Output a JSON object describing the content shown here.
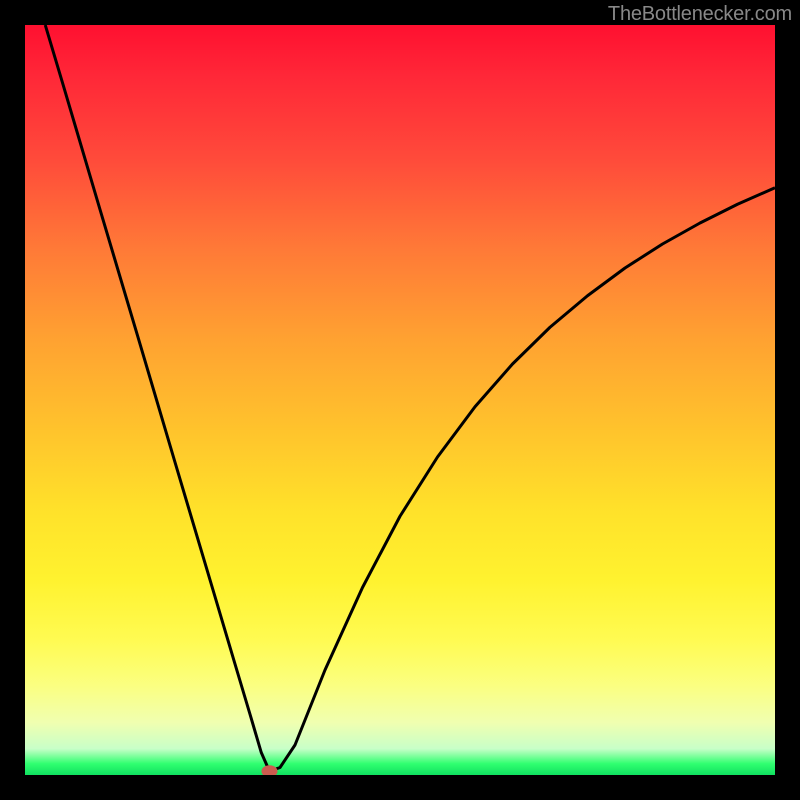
{
  "watermark": "TheBottlenecker.com",
  "chart_data": {
    "type": "line",
    "title": "",
    "xlabel": "",
    "ylabel": "",
    "xlim": [
      0,
      100
    ],
    "ylim": [
      0,
      100
    ],
    "legend": false,
    "grid": false,
    "background_gradient": {
      "top": "#ff1030",
      "mid": "#ffe22a",
      "bottom": "#10e060"
    },
    "marker": {
      "x": 32.6,
      "y": 0.5,
      "color": "#cc5b4f"
    },
    "series": [
      {
        "name": "curve",
        "color": "#000000",
        "x": [
          2.7,
          5,
          10,
          15,
          20,
          25,
          28,
          30,
          31.5,
          32.6,
          34,
          36,
          40,
          45,
          50,
          55,
          60,
          65,
          70,
          75,
          80,
          85,
          90,
          95,
          100
        ],
        "y": [
          100,
          92.3,
          75.4,
          58.6,
          41.7,
          24.9,
          14.8,
          8.1,
          3.0,
          0.5,
          1.0,
          4.0,
          14.0,
          25.0,
          34.5,
          42.4,
          49.1,
          54.8,
          59.7,
          63.9,
          67.6,
          70.8,
          73.6,
          76.1,
          78.3
        ]
      }
    ]
  }
}
